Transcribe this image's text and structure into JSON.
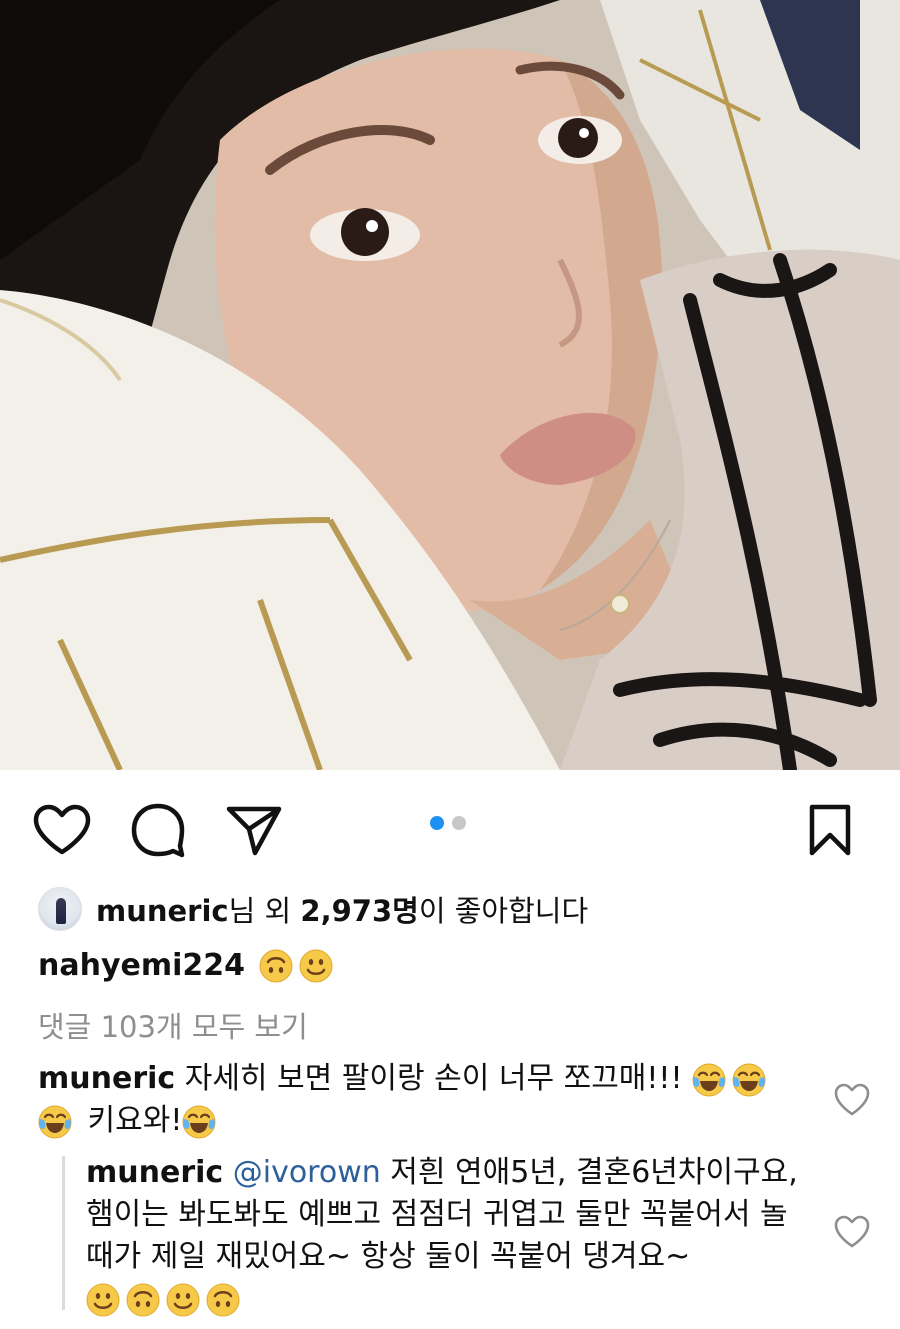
{
  "post": {
    "photo_alt": "selfie photo",
    "carousel": {
      "total": 2,
      "current": 1
    }
  },
  "actions": {
    "like_icon": "heart-icon",
    "comment_icon": "comment-icon",
    "share_icon": "send-icon",
    "save_icon": "bookmark-icon"
  },
  "likes": {
    "user": "muneric",
    "middle": "님 외 ",
    "count": "2,973명",
    "suffix": "이 좋아합니다"
  },
  "caption": {
    "user": "nahyemi224",
    "emojis": [
      "upside-down-face",
      "slightly-smiling-face"
    ]
  },
  "view_all_comments": "댓글 103개 모두 보기",
  "comments": [
    {
      "user": "muneric",
      "text_line1": " 자세히 보면 팔이랑 손이 너무 쪼끄매!!!",
      "text_line2": " 키요와!",
      "emojis": [
        "tears-of-joy",
        "tears-of-joy",
        "tears-of-joy",
        "tears-of-joy"
      ],
      "reply": {
        "user": "muneric",
        "mention": "@ivorown",
        "text": " 저흰 연애5년, 결혼6년차이구요, 햄이는 봐도봐도 예쁘고 점점더 귀엽고 둘만 꼭붙어서 놀때가 제일 재밌어요~ 항상 둘이 꼭붙어 댕겨요~",
        "emojis": [
          "slightly-smiling-face",
          "upside-down-face",
          "slightly-smiling-face",
          "upside-down-face"
        ]
      }
    }
  ],
  "colors": {
    "accent_dot": "#1e90f3",
    "muted_text": "#8e8e8e",
    "mention": "#2d5f9a"
  }
}
